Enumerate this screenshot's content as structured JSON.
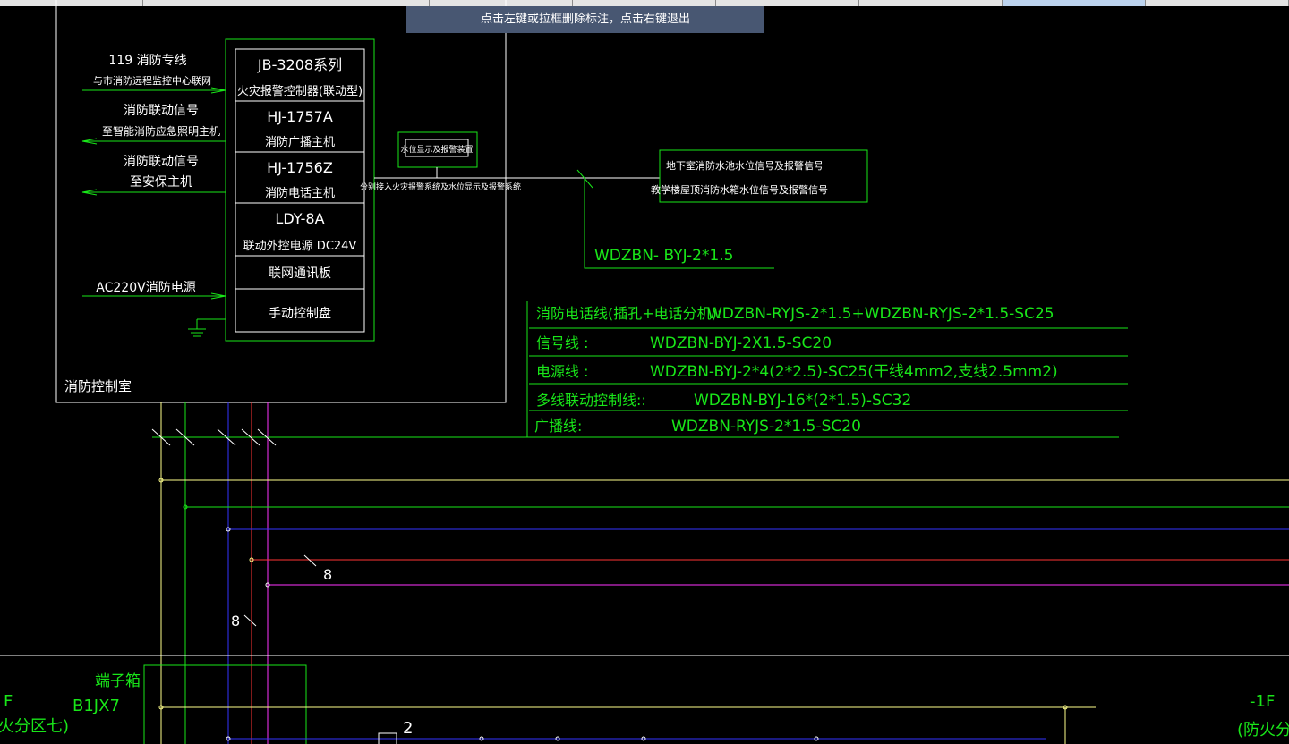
{
  "window": {
    "tabs": [
      {
        "label": "",
        "selected": false
      },
      {
        "label": "",
        "selected": false
      },
      {
        "label": "",
        "selected": false
      },
      {
        "label": "",
        "selected": false
      },
      {
        "label": "",
        "selected": false
      },
      {
        "label": "",
        "selected": false
      },
      {
        "label": "",
        "selected": false
      },
      {
        "label": "",
        "selected": true
      },
      {
        "label": "",
        "selected": false
      }
    ]
  },
  "hint_bar": {
    "text": "点击左键或拉框删除标注，点击右键退出"
  },
  "colors": {
    "green": "#19e619",
    "white": "#ffffff",
    "yellow": "#ffff8c",
    "blue": "#3333ff",
    "red": "#ff3333",
    "magenta": "#ff33ff",
    "hint_bg": "#485772"
  },
  "drawing": {
    "left_inputs": {
      "l1": "119 消防专线",
      "l2": "与市消防远程监控中心联网",
      "l3": "消防联动信号",
      "l4": "至智能消防应急照明主机",
      "l5": "消防联动信号",
      "l6": "至安保主机",
      "l7": "AC220V消防电源"
    },
    "panel": {
      "c1a": "JB-3208系列",
      "c1b": "火灾报警控制器(联动型)",
      "c2a": "HJ-1757A",
      "c2b": "消防广播主机",
      "c3a": "HJ-1756Z",
      "c3b": "消防电话主机",
      "c4a": "LDY-8A",
      "c4b": "联动外控电源 DC24V",
      "c5": "联网通讯板",
      "c6": "手动控制盘"
    },
    "room_label": "消防控制室",
    "water_box": "水位显示及报警装置",
    "water_note": "分别接入火灾报警系统及水位显示及报警系统",
    "signal_box": {
      "l1": "地下室消防水池水位信号及报警信号",
      "l2": "教学楼屋顶消防水箱水位信号及报警信号"
    },
    "cable_label": "WDZBN- BYJ-2*1.5",
    "legend": {
      "r1_name": "消防电话线(插孔+电话分机):",
      "r1_spec": "WDZBN-RYJS-2*1.5+WDZBN-RYJS-2*1.5-SC25",
      "r2_name": "信号线 :",
      "r2_spec": "WDZBN-BYJ-2X1.5-SC20",
      "r3_name": "电源线 :",
      "r3_spec": "WDZBN-BYJ-2*4(2*2.5)-SC25(干线4mm2,支线2.5mm2)",
      "r4_name": "多线联动控制线::",
      "r4_spec": "WDZBN-BYJ-16*(2*1.5)-SC32",
      "r5_name": "广播线:",
      "r5_spec": "WDZBN-RYJS-2*1.5-SC20"
    },
    "count_a": "8",
    "count_b": "8",
    "terminal_box": {
      "name": "端子箱",
      "code": "B1JX7"
    },
    "floor_left_a": "F",
    "floor_left_b": "火分区七)",
    "floor_right_a": "-1F",
    "floor_right_b": "(防火分",
    "bottom_count": "2"
  }
}
